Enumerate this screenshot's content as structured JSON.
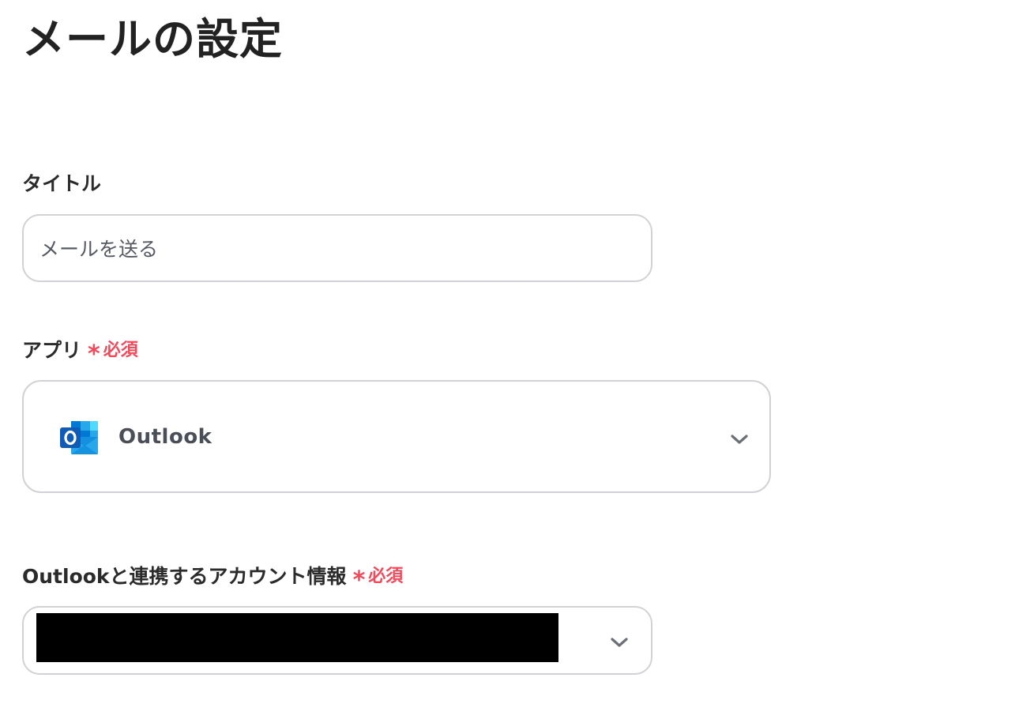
{
  "page": {
    "title": "メールの設定"
  },
  "fields": {
    "title": {
      "label": "タイトル",
      "value": "メールを送る"
    },
    "app": {
      "label": "アプリ",
      "required_mark": "*",
      "required_text": "必須",
      "selected_app": "Outlook",
      "icon": "outlook-icon"
    },
    "account": {
      "label": "Outlookと連携するアカウント情報",
      "required_mark": "*",
      "required_text": "必須",
      "value_redacted": true
    }
  },
  "colors": {
    "required": "#ef4b5c",
    "border": "#d2d2d6",
    "outlook_blue": "#0f6cbd"
  }
}
